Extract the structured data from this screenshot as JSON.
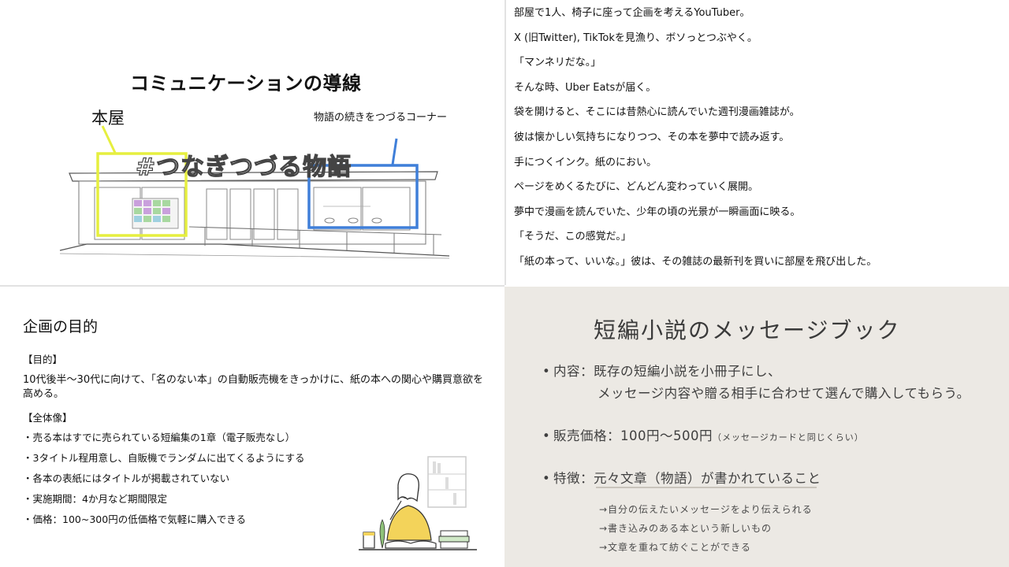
{
  "diagram": {
    "title": "コミュニケーションの導線",
    "label_store": "本屋",
    "label_corner": "物語の続きをつづるコーナー",
    "shop_sign": "#つなぎつづる物語",
    "colors": {
      "store_box": "#e6ef3f",
      "corner_box": "#3f7fd9"
    }
  },
  "story": {
    "lines": [
      "部屋で1人、椅子に座って企画を考えるYouTuber。",
      "X (旧Twitter), TikTokを見漁り、ボソっとつぶやく。",
      "「マンネリだな。」",
      "そんな時、Uber Eatsが届く。",
      "袋を開けると、そこには昔熱心に読んでいた週刊漫画雑誌が。",
      "彼は懐かしい気持ちになりつつ、その本を夢中で読み返す。",
      "手につくインク。紙のにおい。",
      "ページをめくるたびに、どんどん変わっていく展開。",
      "夢中で漫画を読んでいた、少年の頃の光景が一瞬画面に映る。",
      "「そうだ、この感覚だ。」",
      "「紙の本って、いいな。」彼は、その雑誌の最新刊を買いに部屋を飛び出した。"
    ]
  },
  "purpose": {
    "title": "企画の目的",
    "goal_heading": "【目的】",
    "goal_text": "10代後半〜30代に向けて、「名のない本」の自動販売機をきっかけに、紙の本への関心や購買意欲を高める。",
    "overview_heading": "【全体像】",
    "items": [
      "・売る本はすでに売られている短編集の1章（電子販売なし）",
      "・3タイトル程用意し、自販機でランダムに出てくるようにする",
      "・各本の表紙にはタイトルが掲載されていない",
      "・実施期間：4か月など期間限定",
      "・価格：100~300円の低価格で気軽に購入できる"
    ]
  },
  "messagebook": {
    "title": "短編小説のメッセージブック",
    "bullet": "•",
    "content_label": "内容：",
    "content_line1": "既存の短編小説を小冊子にし、",
    "content_line2": "メッセージ内容や贈る相手に合わせて選んで購入してもらう。",
    "price_label": "販売価格：",
    "price_value": "100円〜500円",
    "price_note": "（メッセージカードと同じくらい）",
    "feature_label": "特徴：",
    "feature_value": "元々文章（物語）が書かれていること",
    "arrows": [
      "→自分の伝えたいメッセージをより伝えられる",
      "→書き込みのある本という新しいもの",
      "→文章を重ねて紡ぐことができる"
    ],
    "colors": {
      "background": "#ece9e4",
      "text": "#3f3f3f"
    }
  }
}
